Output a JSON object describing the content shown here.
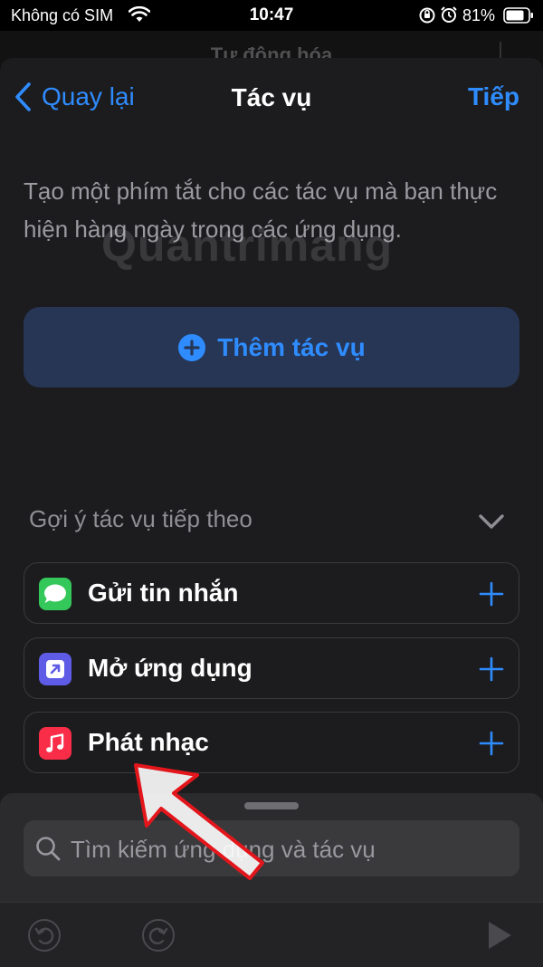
{
  "status_bar": {
    "carrier": "Không có SIM",
    "time": "10:47",
    "battery": "81%"
  },
  "background_screen": {
    "title": "Tự động hóa"
  },
  "nav": {
    "back_label": "Quay lại",
    "title": "Tác vụ",
    "next_label": "Tiếp"
  },
  "description": "Tạo một phím tắt cho các tác vụ mà bạn thực hiện hàng ngày trong các ứng dụng.",
  "watermark": "Quantrimang",
  "add_action": {
    "label": "Thêm tác vụ"
  },
  "suggestions": {
    "header": "Gợi ý tác vụ tiếp theo",
    "items": [
      {
        "label": "Gửi tin nhắn",
        "icon": "messages-app-icon",
        "color": "#34c759"
      },
      {
        "label": "Mở ứng dụng",
        "icon": "open-app-icon",
        "color": "#5e5ce6"
      },
      {
        "label": "Phát nhạc",
        "icon": "music-app-icon",
        "color": "#fa2d48"
      }
    ]
  },
  "search": {
    "placeholder": "Tìm kiếm ứng dụng và tác vụ"
  },
  "colors": {
    "accent": "#2f8cff",
    "sheet_bg": "#1c1c1e",
    "annotation_arrow": "#e3161b"
  }
}
